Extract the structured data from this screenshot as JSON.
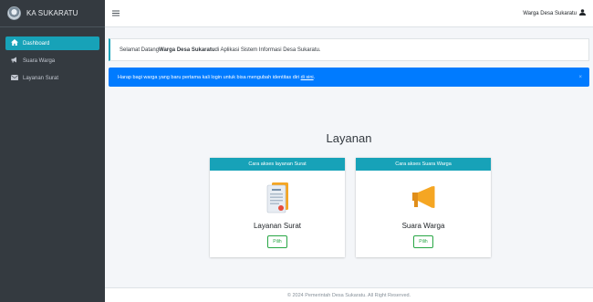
{
  "brand": {
    "name": "KA SUKARATU"
  },
  "sidebar": {
    "items": [
      {
        "label": "Dashboard",
        "icon": "home-icon",
        "active": true
      },
      {
        "label": "Suara Warga",
        "icon": "megaphone-icon",
        "active": false
      },
      {
        "label": "Layanan Surat",
        "icon": "envelope-icon",
        "active": false
      }
    ]
  },
  "header": {
    "user_name": "Warga Desa Sukaratu",
    "user_icon": "user-icon"
  },
  "welcome": {
    "prefix": "Selamat Datang ",
    "bold": "Warga Desa Sukaratu",
    "suffix": " di Aplikasi Sistem Informasi Desa Sukaratu."
  },
  "info": {
    "text": "Harap bagi warga yang baru pertama kali login untuk bisa mengubah identitas diri ",
    "link": "di sini",
    "end": ".",
    "close": "×"
  },
  "layanan": {
    "title": "Layanan",
    "cards": [
      {
        "header": "Cara akses layanan Surat",
        "title": "Layanan Surat",
        "button": "Pilih",
        "icon": "document-icon"
      },
      {
        "header": "Cara akses Suara Warga",
        "title": "Suara Warga",
        "button": "Pilih",
        "icon": "megaphone-icon"
      }
    ]
  },
  "footer": {
    "text": "© 2024 Pemerintah Desa Sukaratu. All Right Reserved."
  },
  "colors": {
    "sidebar": "#343a40",
    "accent": "#17a2b8",
    "info": "#007bff",
    "success": "#28a745"
  }
}
